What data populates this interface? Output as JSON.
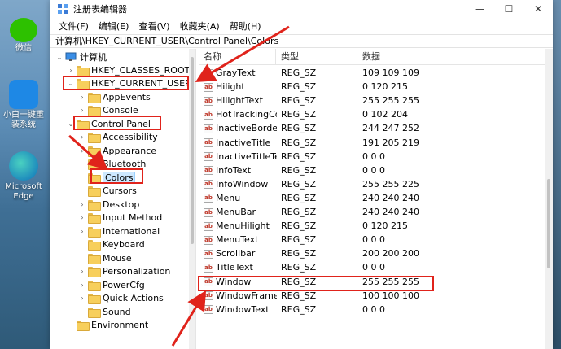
{
  "desktop": {
    "icons": [
      {
        "label": "微信",
        "color": "#2dc100"
      },
      {
        "label": "小白一键重装系统",
        "color": "#1e88e5"
      },
      {
        "label": "Microsoft Edge",
        "color": "#1a9e8f"
      }
    ]
  },
  "window": {
    "title": "注册表编辑器",
    "controls": {
      "minimize": "—",
      "maximize": "☐",
      "close": "✕"
    },
    "menu": [
      "文件(F)",
      "编辑(E)",
      "查看(V)",
      "收藏夹(A)",
      "帮助(H)"
    ],
    "address": "计算机\\HKEY_CURRENT_USER\\Control Panel\\Colors"
  },
  "tree": {
    "root": "计算机",
    "nodes": [
      {
        "label": "HKEY_CLASSES_ROOT",
        "expander": "›"
      },
      {
        "label": "HKEY_CURRENT_USER",
        "expander": "⌄"
      },
      {
        "label": "AppEvents",
        "expander": "›"
      },
      {
        "label": "Console",
        "expander": "›"
      },
      {
        "label": "Control Panel",
        "expander": "⌄"
      },
      {
        "label": "Accessibility",
        "expander": "›"
      },
      {
        "label": "Appearance",
        "expander": "›"
      },
      {
        "label": "Bluetooth",
        "expander": ""
      },
      {
        "label": "Colors",
        "expander": ""
      },
      {
        "label": "Cursors",
        "expander": ""
      },
      {
        "label": "Desktop",
        "expander": "›"
      },
      {
        "label": "Input Method",
        "expander": "›"
      },
      {
        "label": "International",
        "expander": "›"
      },
      {
        "label": "Keyboard",
        "expander": ""
      },
      {
        "label": "Mouse",
        "expander": ""
      },
      {
        "label": "Personalization",
        "expander": "›"
      },
      {
        "label": "PowerCfg",
        "expander": "›"
      },
      {
        "label": "Quick Actions",
        "expander": "›"
      },
      {
        "label": "Sound",
        "expander": ""
      },
      {
        "label": "Environment",
        "expander": ""
      }
    ]
  },
  "list": {
    "headers": {
      "name": "名称",
      "type": "类型",
      "data": "数据"
    },
    "rows": [
      {
        "name": "GrayText",
        "type": "REG_SZ",
        "data": "109 109 109"
      },
      {
        "name": "Hilight",
        "type": "REG_SZ",
        "data": "0 120 215"
      },
      {
        "name": "HilightText",
        "type": "REG_SZ",
        "data": "255 255 255"
      },
      {
        "name": "HotTrackingCo...",
        "type": "REG_SZ",
        "data": "0 102 204"
      },
      {
        "name": "InactiveBorder",
        "type": "REG_SZ",
        "data": "244 247 252"
      },
      {
        "name": "InactiveTitle",
        "type": "REG_SZ",
        "data": "191 205 219"
      },
      {
        "name": "InactiveTitleText",
        "type": "REG_SZ",
        "data": "0 0 0"
      },
      {
        "name": "InfoText",
        "type": "REG_SZ",
        "data": "0 0 0"
      },
      {
        "name": "InfoWindow",
        "type": "REG_SZ",
        "data": "255 255 225"
      },
      {
        "name": "Menu",
        "type": "REG_SZ",
        "data": "240 240 240"
      },
      {
        "name": "MenuBar",
        "type": "REG_SZ",
        "data": "240 240 240"
      },
      {
        "name": "MenuHilight",
        "type": "REG_SZ",
        "data": "0 120 215"
      },
      {
        "name": "MenuText",
        "type": "REG_SZ",
        "data": "0 0 0"
      },
      {
        "name": "Scrollbar",
        "type": "REG_SZ",
        "data": "200 200 200"
      },
      {
        "name": "TitleText",
        "type": "REG_SZ",
        "data": "0 0 0"
      },
      {
        "name": "Window",
        "type": "REG_SZ",
        "data": "255 255 255"
      },
      {
        "name": "WindowFrame",
        "type": "REG_SZ",
        "data": "100 100 100"
      },
      {
        "name": "WindowText",
        "type": "REG_SZ",
        "data": "0 0 0"
      }
    ]
  },
  "value_icon_text": "ab",
  "annotation_color": "#e0231b"
}
